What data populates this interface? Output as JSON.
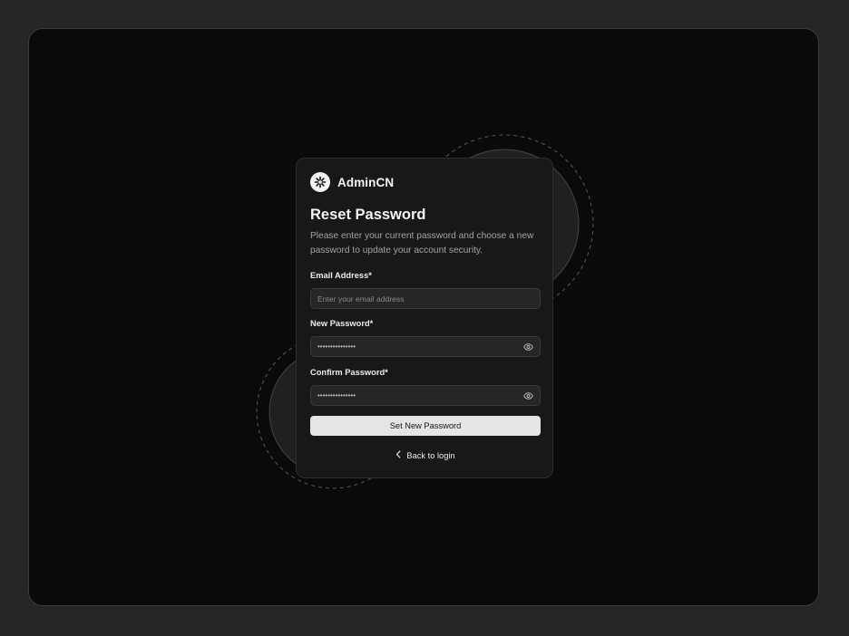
{
  "app": {
    "brand_name": "AdminCN"
  },
  "form": {
    "title": "Reset Password",
    "subtitle": "Please enter your current password and choose a new password to update your account security.",
    "email": {
      "label": "Email Address*",
      "placeholder": "Enter your email address",
      "value": ""
    },
    "new_password": {
      "label": "New Password*",
      "value": "•••••••••••••••"
    },
    "confirm_password": {
      "label": "Confirm Password*",
      "value": "•••••••••••••••"
    },
    "submit_label": "Set New Password",
    "back_label": "Back to login"
  },
  "icons": {
    "logo": "asterisk-logo-icon",
    "toggle_visibility": "eye-icon",
    "back": "chevron-left-icon"
  },
  "colors": {
    "page_bg": "#262626",
    "frame_bg": "#0a0a0a",
    "card_bg": "#181818",
    "button_bg": "#e5e5e5"
  }
}
